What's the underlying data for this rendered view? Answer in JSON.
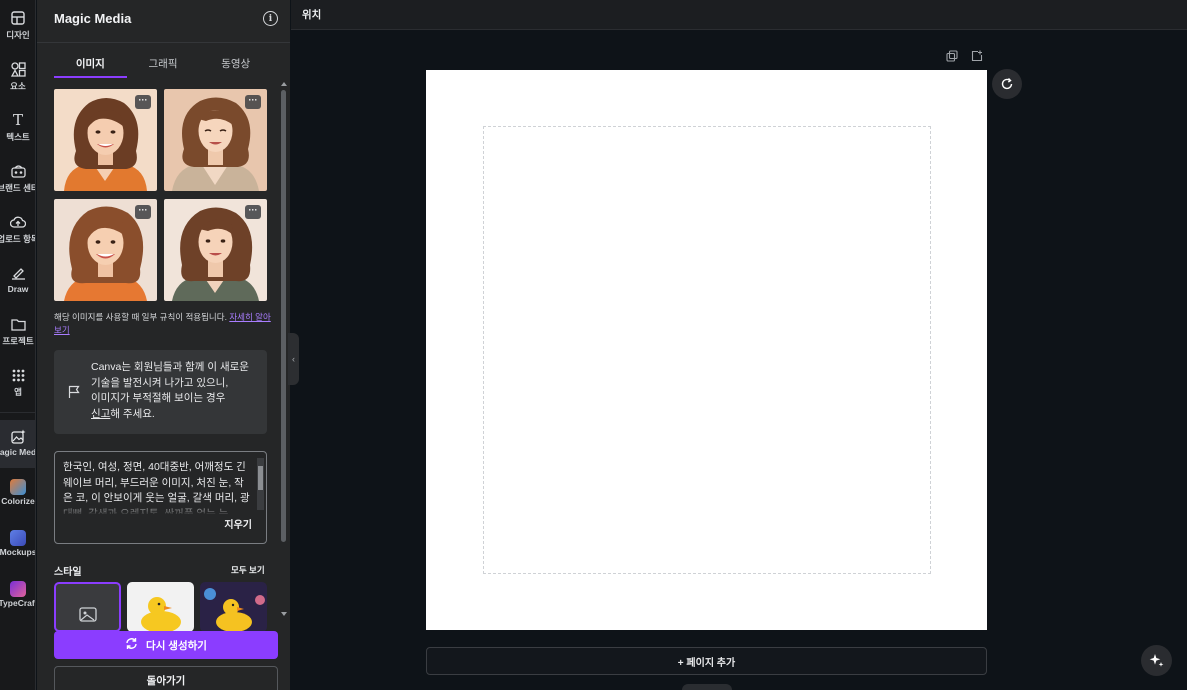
{
  "rail": {
    "items": [
      {
        "icon": "design-icon",
        "label": "디자인"
      },
      {
        "icon": "elements-icon",
        "label": "요소"
      },
      {
        "icon": "text-icon",
        "label": "텍스트"
      },
      {
        "icon": "brand-icon",
        "label": "브랜드 센터"
      },
      {
        "icon": "uploads-icon",
        "label": "업로드 항목"
      },
      {
        "icon": "draw-icon",
        "label": "Draw"
      },
      {
        "icon": "projects-icon",
        "label": "프로젝트"
      },
      {
        "icon": "apps-icon",
        "label": "앱"
      },
      {
        "icon": "magic-media-icon",
        "label": "Magic Med..."
      },
      {
        "icon": "colorize-icon",
        "label": "Colorize"
      },
      {
        "icon": "mockups-icon",
        "label": "Mockups"
      },
      {
        "icon": "typecraft-icon",
        "label": "TypeCraft"
      }
    ]
  },
  "panel": {
    "title": "Magic Media",
    "tabs": [
      "이미지",
      "그래픽",
      "동영상"
    ],
    "active_tab": "이미지",
    "notice_text": "해당 이미지를 사용할 때 일부 규칙이 적용됩니다.",
    "notice_link": "자세히 알아보기",
    "report": {
      "line1": "Canva는 회원님들과 함께 이 새로운",
      "line2": "기술을 발전시켜 나가고 있으니,",
      "line3": "이미지가 부적절해 보이는 경우",
      "link": "신고",
      "line4_rest": "해 주세요."
    },
    "prompt": "한국인, 여성, 정면, 40대중반, 어깨정도 긴 웨이브 머리, 부드러운 이미지, 처진 눈, 작은 코, 이 안보이게 웃는 얼굴, 갈색 머리, 광대뼈, 갈색과 오렌지톤, 쌍꺼풀 없는 눈",
    "clear_label": "지우기",
    "style_label": "스타일",
    "see_all_label": "모두 보기",
    "generate_label": "다시 생성하기",
    "back_label": "돌아가기",
    "more_label": "···"
  },
  "topbar": {
    "position_label": "위치"
  },
  "canvas": {
    "add_page_label": "+ 페이지 추가"
  },
  "colors": {
    "accent": "#8b3dff",
    "panel_bg": "#252627",
    "canvas_bg": "#0e1318"
  }
}
